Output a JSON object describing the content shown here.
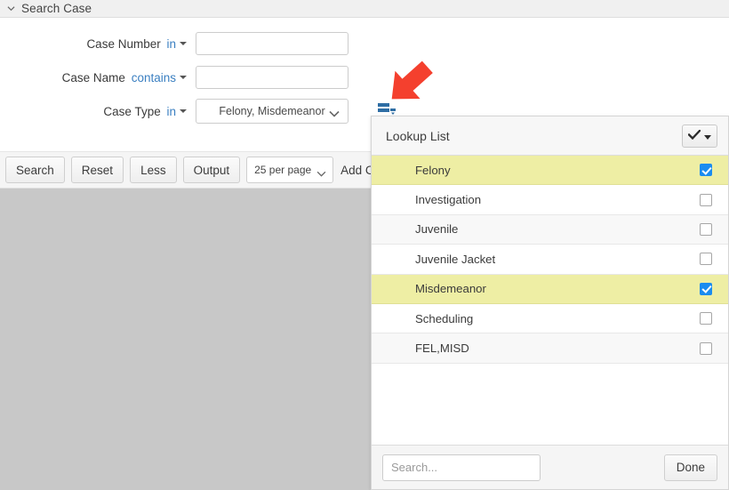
{
  "header": {
    "title": "Search Case",
    "collapse_icon": "chevron-down-icon"
  },
  "form": {
    "fields": [
      {
        "label": "Case Number",
        "operator": "in",
        "type": "text",
        "value": "",
        "placeholder": ""
      },
      {
        "label": "Case Name",
        "operator": "contains",
        "type": "text",
        "value": "",
        "placeholder": ""
      },
      {
        "label": "Case Type",
        "operator": "in",
        "type": "select",
        "value": "Felony, Misdemeanor",
        "placeholder": ""
      }
    ]
  },
  "toolbar": {
    "search_label": "Search",
    "reset_label": "Reset",
    "less_label": "Less",
    "output_label": "Output",
    "per_page_value": "25 per page",
    "add_criteria_label": "Add Criteria"
  },
  "lookup": {
    "title": "Lookup List",
    "check_all_icon": "checkmark-dropdown-icon",
    "items": [
      {
        "label": "Felony",
        "checked": true,
        "selected": true
      },
      {
        "label": "Investigation",
        "checked": false,
        "selected": false
      },
      {
        "label": "Juvenile",
        "checked": false,
        "selected": false
      },
      {
        "label": "Juvenile Jacket",
        "checked": false,
        "selected": false
      },
      {
        "label": "Misdemeanor",
        "checked": true,
        "selected": true
      },
      {
        "label": "Scheduling",
        "checked": false,
        "selected": false
      },
      {
        "label": "FEL,MISD",
        "checked": false,
        "selected": false
      }
    ],
    "search_placeholder": "Search...",
    "search_value": "",
    "done_label": "Done"
  },
  "annotation": {
    "arrow_color": "#f4402e",
    "target_icon": "list-menu-icon"
  },
  "colors": {
    "selected_row": "#eeeea4",
    "checkbox_checked": "#1a8cf0",
    "link": "#3a7fc1",
    "results_background": "#c8c8c8"
  }
}
